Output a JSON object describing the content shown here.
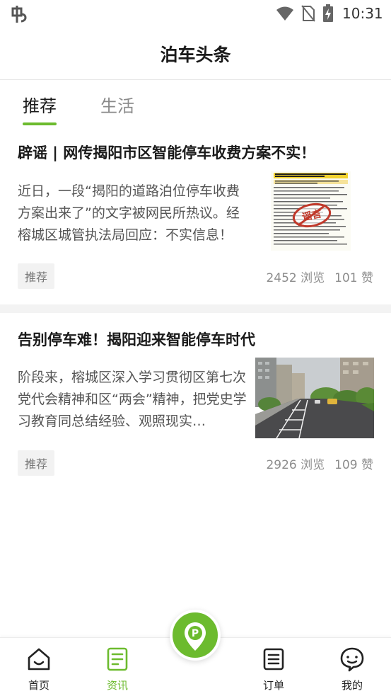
{
  "status_bar": {
    "time": "10:31",
    "icons": [
      "app-logo-icon",
      "wifi-icon",
      "no-sim-icon",
      "battery-charging-icon"
    ]
  },
  "header": {
    "title": "泊车头条"
  },
  "tabs": [
    {
      "label": "推荐",
      "active": true
    },
    {
      "label": "生活",
      "active": false
    }
  ],
  "articles": [
    {
      "title": "辟谣 | 网传揭阳市区智能停车收费方案不实！",
      "summary": "近日，一段“揭阳的道路泊位停车收费方案出来了”的文字被网民所热议。经榕城区城管执法局回应：不实信息！",
      "tag": "推荐",
      "views": "2452 浏览",
      "likes": "101 赞",
      "thumbnail": {
        "kind": "document-with-stamp",
        "stamp_text": "谣言"
      }
    },
    {
      "title": "告别停车难！揭阳迎来智能停车时代",
      "summary": "阶段来，榕城区深入学习贯彻区第七次党代会精神和区“两会”精神，把党史学习教育同总结经验、观照现实…",
      "tag": "推荐",
      "views": "2926 浏览",
      "likes": "109 赞",
      "thumbnail": {
        "kind": "street-parking-photo"
      }
    }
  ],
  "bottom_nav": {
    "items": [
      {
        "label": "首页",
        "icon": "home-icon",
        "active": false
      },
      {
        "label": "资讯",
        "icon": "news-icon",
        "active": true
      },
      {
        "label": "订单",
        "icon": "orders-icon",
        "active": false
      },
      {
        "label": "我的",
        "icon": "profile-icon",
        "active": false
      }
    ],
    "center_button_icon": "parking-location-icon"
  },
  "colors": {
    "accent": "#6cbb2e",
    "text_primary": "#1a1a1a",
    "text_secondary": "#555555",
    "text_muted": "#8c8c8c",
    "divider": "#f3f3f3"
  }
}
